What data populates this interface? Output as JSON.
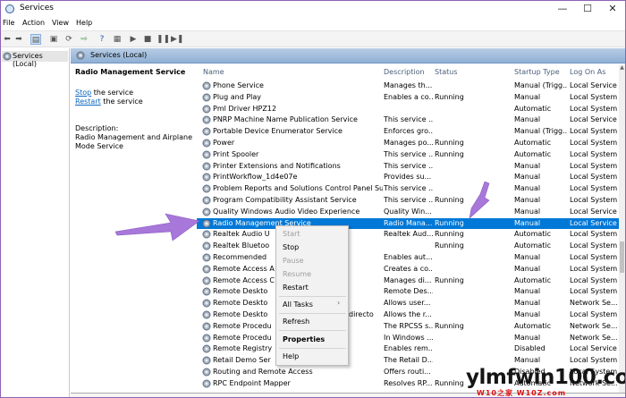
{
  "window": {
    "title": "Services",
    "minimize": "—",
    "maximize": "☐",
    "close": "✕"
  },
  "menubar": [
    "File",
    "Action",
    "View",
    "Help"
  ],
  "tree": {
    "root_label": "Services (Local)"
  },
  "header": {
    "title": "Services (Local)"
  },
  "detail": {
    "service_name": "Radio Management Service",
    "stop_link": "Stop",
    "stop_suffix": " the service",
    "restart_link": "Restart",
    "restart_suffix": " the service",
    "description_label": "Description:",
    "description_line1": "Radio Management and Airplane",
    "description_line2": "Mode Service"
  },
  "columns": {
    "name": "Name",
    "description": "Description",
    "status": "Status",
    "startup": "Startup Type",
    "logon": "Log On As"
  },
  "services": [
    {
      "name": "Phone Service",
      "desc": "Manages th...",
      "status": "",
      "startup": "Manual (Trigg...",
      "logon": "Local Service"
    },
    {
      "name": "Plug and Play",
      "desc": "Enables a co...",
      "status": "Running",
      "startup": "Manual",
      "logon": "Local System"
    },
    {
      "name": "Pml Driver HPZ12",
      "desc": "",
      "status": "",
      "startup": "Automatic",
      "logon": "Local System"
    },
    {
      "name": "PNRP Machine Name Publication Service",
      "desc": "This service ...",
      "status": "",
      "startup": "Manual",
      "logon": "Local Service"
    },
    {
      "name": "Portable Device Enumerator Service",
      "desc": "Enforces gro...",
      "status": "",
      "startup": "Manual (Trigg...",
      "logon": "Local System"
    },
    {
      "name": "Power",
      "desc": "Manages po...",
      "status": "Running",
      "startup": "Automatic",
      "logon": "Local System"
    },
    {
      "name": "Print Spooler",
      "desc": "This service ...",
      "status": "Running",
      "startup": "Automatic",
      "logon": "Local System"
    },
    {
      "name": "Printer Extensions and Notifications",
      "desc": "This service ...",
      "status": "",
      "startup": "Manual",
      "logon": "Local System"
    },
    {
      "name": "PrintWorkflow_1d4e07e",
      "desc": "Provides su...",
      "status": "",
      "startup": "Manual",
      "logon": "Local System"
    },
    {
      "name": "Problem Reports and Solutions Control Panel Supp...",
      "desc": "This service ...",
      "status": "",
      "startup": "Manual",
      "logon": "Local System"
    },
    {
      "name": "Program Compatibility Assistant Service",
      "desc": "This service ...",
      "status": "Running",
      "startup": "Manual",
      "logon": "Local System"
    },
    {
      "name": "Quality Windows Audio Video Experience",
      "desc": "Quality Win...",
      "status": "",
      "startup": "Manual",
      "logon": "Local Service"
    },
    {
      "name": "Radio Management Service",
      "desc": "Radio Mana...",
      "status": "Running",
      "startup": "Manual",
      "logon": "Local Service"
    },
    {
      "name": "Realtek Audio U",
      "desc": "Realtek Aud...",
      "status": "Running",
      "startup": "Automatic",
      "logon": "Local System"
    },
    {
      "name": "Realtek Bluetoo",
      "desc": "",
      "status": "Running",
      "startup": "Automatic",
      "logon": "Local System"
    },
    {
      "name": "Recommended",
      "desc": "Enables aut...",
      "status": "",
      "startup": "Manual",
      "logon": "Local System"
    },
    {
      "name": "Remote Access A",
      "desc": "Creates a co...",
      "status": "",
      "startup": "Manual",
      "logon": "Local System"
    },
    {
      "name": "Remote Access C",
      "desc": "Manages di...",
      "status": "Running",
      "startup": "Automatic",
      "logon": "Local System"
    },
    {
      "name": "Remote Deskto",
      "desc": "Remote Des...",
      "status": "",
      "startup": "Manual",
      "logon": "Local System"
    },
    {
      "name": "Remote Deskto",
      "desc": "Allows user...",
      "status": "",
      "startup": "Manual",
      "logon": "Network Se..."
    },
    {
      "name": "Remote Deskto",
      "suffix": "directo",
      "desc": "Allows the r...",
      "status": "",
      "startup": "Manual",
      "logon": "Local System"
    },
    {
      "name": "Remote Procedu",
      "desc": "The RPCSS s...",
      "status": "Running",
      "startup": "Automatic",
      "logon": "Network Se..."
    },
    {
      "name": "Remote Procedu",
      "desc": "In Windows ...",
      "status": "",
      "startup": "Manual",
      "logon": "Network Se..."
    },
    {
      "name": "Remote Registry",
      "desc": "Enables rem...",
      "status": "",
      "startup": "Disabled",
      "logon": "Local Service"
    },
    {
      "name": "Retail Demo Ser",
      "desc": "The Retail D...",
      "status": "",
      "startup": "Manual",
      "logon": "Local System"
    },
    {
      "name": "Routing and Remote Access",
      "desc": "Offers routi...",
      "status": "",
      "startup": "Disabled",
      "logon": "Local System"
    },
    {
      "name": "RPC Endpoint Mapper",
      "desc": "Resolves RP...",
      "status": "Running",
      "startup": "Automatic",
      "logon": "Network Se..."
    }
  ],
  "selected_index": 12,
  "context_menu": {
    "start": "Start",
    "stop": "Stop",
    "pause": "Pause",
    "resume": "Resume",
    "restart": "Restart",
    "all_tasks": "All Tasks",
    "all_tasks_arrow": "›",
    "refresh": "Refresh",
    "properties": "Properties",
    "help": "Help"
  },
  "watermark": {
    "main": "ylmfwin100.com",
    "sub": "W10之家 W10Z.com"
  },
  "colors": {
    "selection": "#0078d7",
    "header_bar": "#9db9da",
    "arrow": "#a777d9",
    "link": "#0a66c2"
  }
}
